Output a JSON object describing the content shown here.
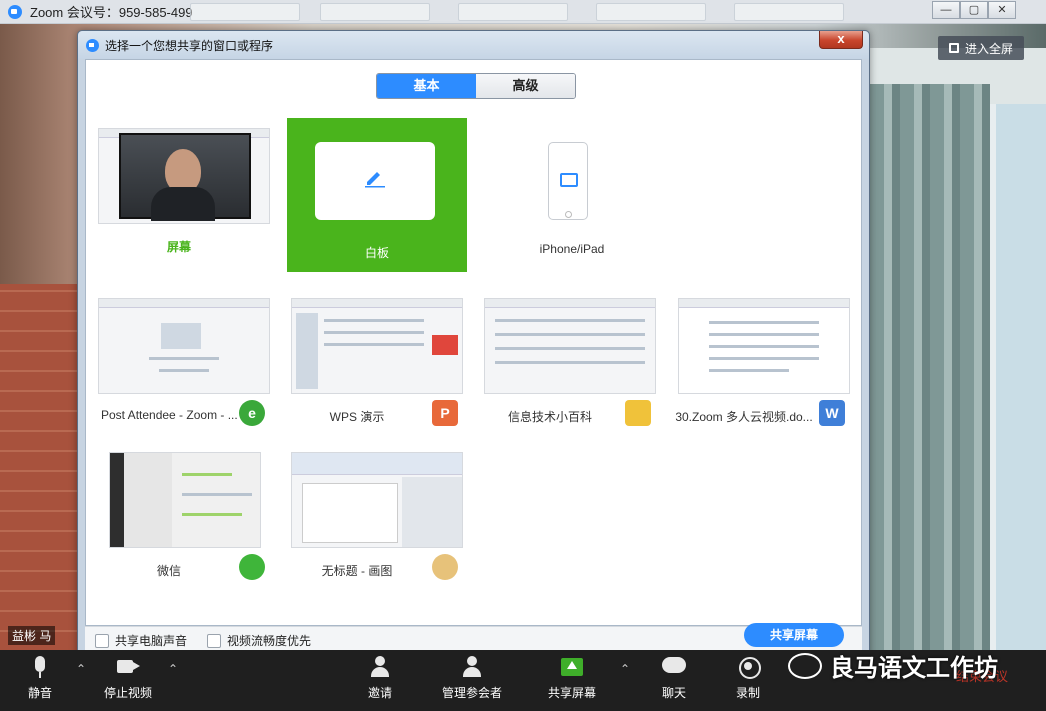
{
  "zoom_window": {
    "title": "Zoom 会议号：959-585-499",
    "controls": [
      "—",
      "▢",
      "✕"
    ],
    "fullscreen_label": "进入全屏"
  },
  "dialog": {
    "title": "选择一个您想共享的窗口或程序",
    "close_label": "x",
    "tabs": [
      {
        "label": "基本",
        "active": true
      },
      {
        "label": "高级",
        "active": false
      }
    ],
    "tiles": [
      {
        "label": "屏幕",
        "selected": false
      },
      {
        "label": "白板",
        "selected": true
      },
      {
        "label": "iPhone/iPad",
        "selected": false
      },
      {
        "label": "Post Attendee - Zoom - ...",
        "icon": "ie-icon"
      },
      {
        "label": "WPS 演示",
        "icon": "wps-presentation-icon",
        "icon_glyph": "P"
      },
      {
        "label": "信息技术小百科",
        "icon": "folder-icon"
      },
      {
        "label": "30.Zoom 多人云视频.do...",
        "icon": "wps-writer-icon",
        "icon_glyph": "W"
      },
      {
        "label": "微信",
        "icon": "wechat-icon"
      },
      {
        "label": "无标题 - 画图",
        "icon": "paint-palette-icon"
      }
    ],
    "footer": {
      "share_audio_label": "共享电脑声音",
      "optimize_video_label": "视频流畅度优先",
      "share_button_label": "共享屏幕"
    }
  },
  "participant_name": "益彬 马",
  "toolbar": {
    "items": [
      {
        "label": "静音",
        "icon": "microphone-icon"
      },
      {
        "label": "停止视频",
        "icon": "video-camera-icon"
      },
      {
        "label": "邀请",
        "icon": "invite-icon"
      },
      {
        "label": "管理参会者",
        "icon": "participants-icon"
      },
      {
        "label": "共享屏幕",
        "icon": "share-screen-icon"
      },
      {
        "label": "聊天",
        "icon": "chat-icon"
      },
      {
        "label": "录制",
        "icon": "record-icon"
      }
    ],
    "end_label": "结束会议"
  },
  "watermark": "良马语文工作坊",
  "colors": {
    "accent_blue": "#2d8cff",
    "selected_green": "#4ab41c",
    "toolbar_bg": "#1f1f1f"
  }
}
